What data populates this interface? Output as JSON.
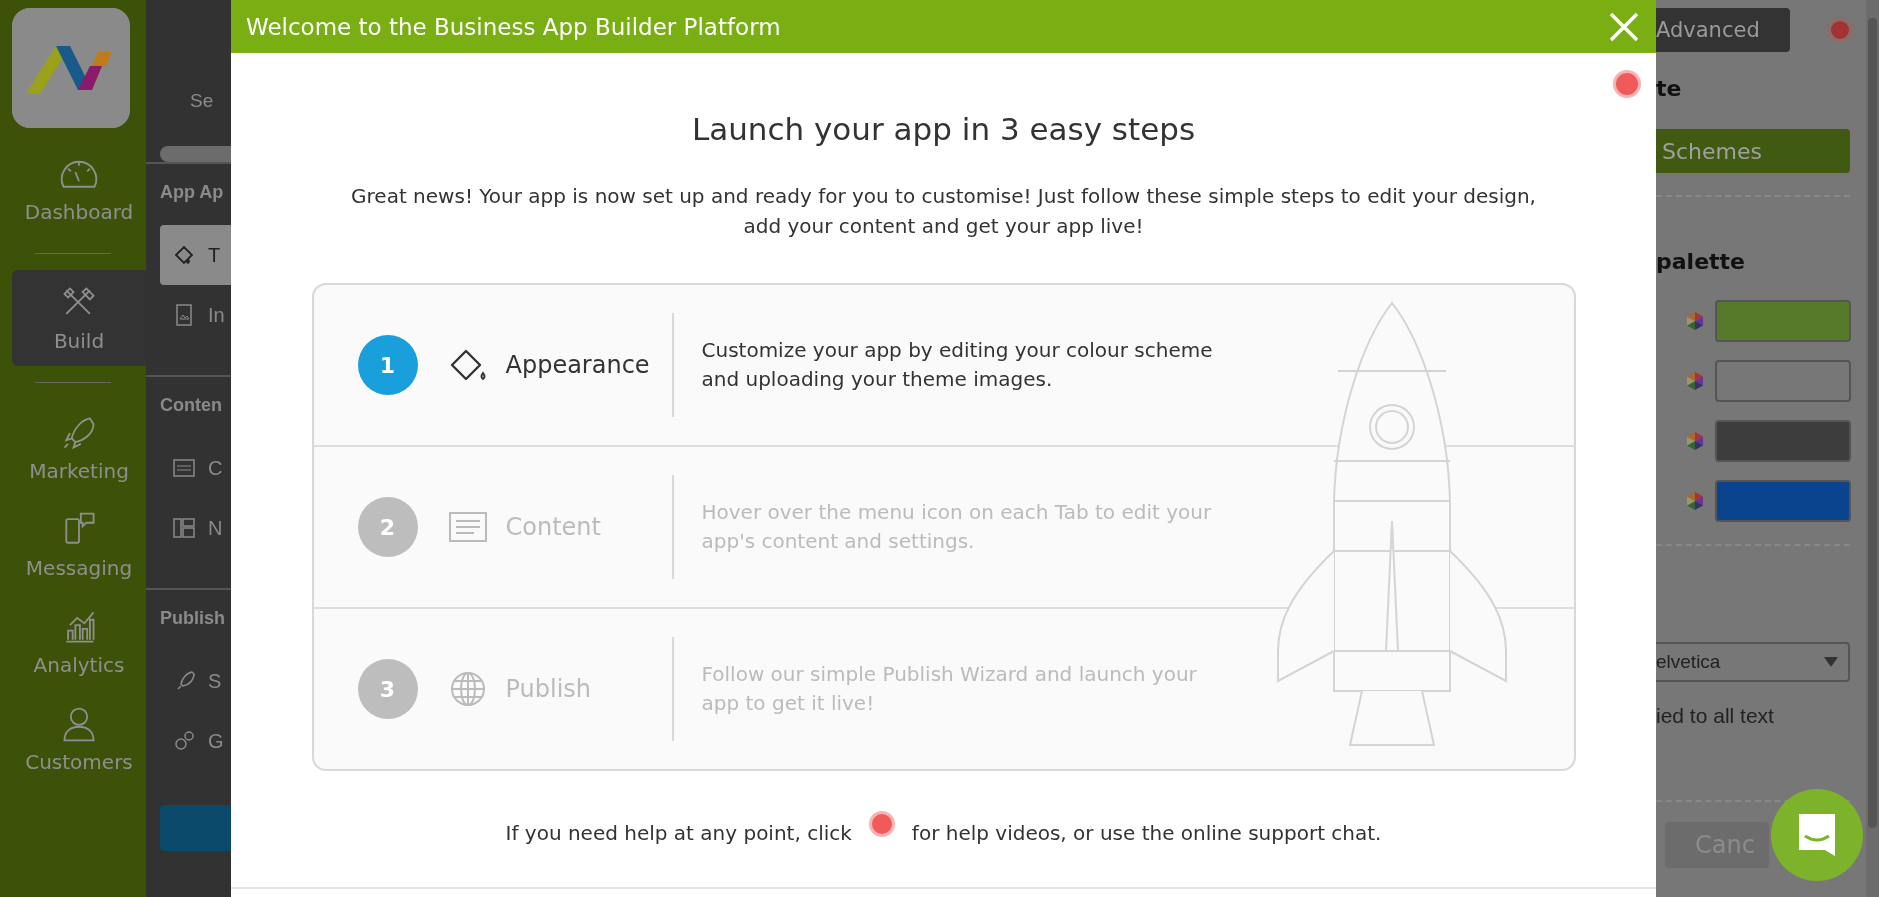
{
  "nav": {
    "items": [
      {
        "label": "Dashboard",
        "selected": false
      },
      {
        "label": "Build",
        "selected": true
      },
      {
        "label": "Marketing",
        "selected": false
      },
      {
        "label": "Messaging",
        "selected": false
      },
      {
        "label": "Analytics",
        "selected": false
      },
      {
        "label": "Customers",
        "selected": false
      }
    ]
  },
  "side_panel": {
    "search": {
      "placeholder": "Se"
    },
    "sections": [
      {
        "title": "App Ap",
        "items": [
          {
            "label": "T",
            "selected": true
          },
          {
            "label": "In",
            "selected": false
          }
        ]
      },
      {
        "title": "Conten",
        "items": [
          {
            "label": "C",
            "selected": false
          },
          {
            "label": "N",
            "selected": false
          }
        ]
      },
      {
        "title": "Publish",
        "items": [
          {
            "label": "S",
            "selected": false
          },
          {
            "label": "G",
            "selected": false
          }
        ]
      }
    ]
  },
  "right_panel": {
    "advanced_button": "Advanced",
    "heading": "te",
    "schemes_button": "Schemes",
    "palette_heading": "palette",
    "swatches": [
      {
        "color": "#577a2a"
      },
      {
        "color": "#777777"
      },
      {
        "color": "#3d3d3d"
      },
      {
        "color": "#0a448f"
      }
    ],
    "font_select": {
      "value": "elvetica"
    },
    "font_note": "ied to all text",
    "cancel_button": "Canc"
  },
  "modal": {
    "title": "Welcome to the Business App Builder Platform",
    "heading": "Launch your app in 3 easy steps",
    "intro": "Great news! Your app is now set up and ready for you to customise! Just follow these simple steps to edit your design, add your content and get your app live!",
    "steps": [
      {
        "number": "1",
        "label": "Appearance",
        "description": "Customize your app by editing your colour scheme and uploading your theme images.",
        "active": true
      },
      {
        "number": "2",
        "label": "Content",
        "description": "Hover over the menu icon on each Tab to edit your app's content and settings.",
        "active": false
      },
      {
        "number": "3",
        "label": "Publish",
        "description": "Follow our simple Publish Wizard and launch your app to get it live!",
        "active": false
      }
    ],
    "help_before": "If you need help at any point, click",
    "help_after": "for help videos, or use the online support chat."
  }
}
